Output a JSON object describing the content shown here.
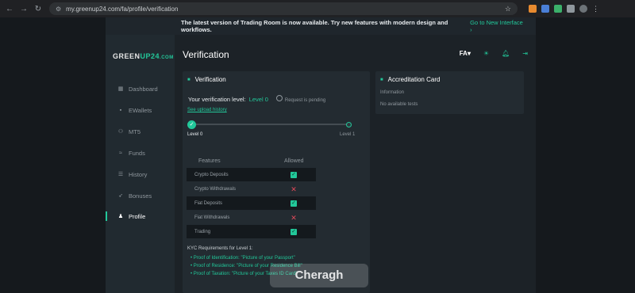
{
  "browser": {
    "url": "my.greenup24.com/fa/profile/verification"
  },
  "banner": {
    "message": "The latest version of Trading Room is now available. Try new features with modern design and workflows.",
    "link": "Go to New Interface"
  },
  "logo": {
    "part1": "GREEN",
    "part2": "UP24",
    "part3": ".COM"
  },
  "sidebar": {
    "items": [
      {
        "label": "Dashboard",
        "icon": "grid-icon"
      },
      {
        "label": "EWallets",
        "icon": "wallet-icon"
      },
      {
        "label": "MT5",
        "icon": "mt5-icon"
      },
      {
        "label": "Funds",
        "icon": "funds-icon"
      },
      {
        "label": "History",
        "icon": "history-icon"
      },
      {
        "label": "Bonuses",
        "icon": "bonus-icon"
      },
      {
        "label": "Profile",
        "icon": "user-icon",
        "active": true
      }
    ]
  },
  "header": {
    "title": "Verification",
    "language": "FA"
  },
  "verification": {
    "card_title": "Verification",
    "level_label": "Your verification level:",
    "level_value": "Level 0",
    "status": "Request is pending",
    "upload_history_link": "See upload history",
    "progress": {
      "current": "Level 0",
      "target": "Level 1"
    },
    "features_header": "Features",
    "allowed_header": "Allowed",
    "features": [
      {
        "name": "Crypto Deposits",
        "allowed": true
      },
      {
        "name": "Crypto Withdrawals",
        "allowed": false
      },
      {
        "name": "Fiat Deposits",
        "allowed": true
      },
      {
        "name": "Fiat Withdrawals",
        "allowed": false
      },
      {
        "name": "Trading",
        "allowed": true
      }
    ],
    "kyc_title": "KYC Requirements for Level 1:",
    "kyc_items": [
      "Proof of Identification: \"Picture of your Passport\"",
      "Proof of Residence: \"Picture of your Residence Bill\"",
      "Proof of Taxation: \"Picture of your Taxes ID Card\""
    ]
  },
  "accreditation": {
    "card_title": "Accreditation Card",
    "info_label": "Information",
    "empty_text": "No available tests"
  },
  "watermark": "Cheragh",
  "colors": {
    "accent": "#22c89a",
    "danger": "#e0495a",
    "background": "#1c2227",
    "card": "#232b31"
  }
}
